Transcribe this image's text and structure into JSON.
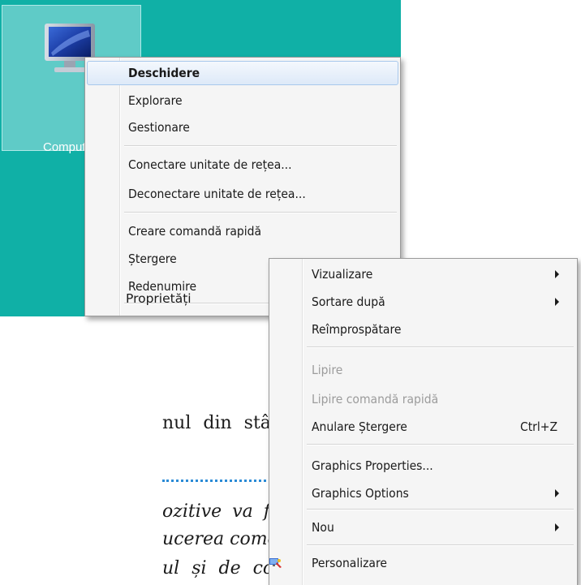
{
  "desktop": {
    "icon_label": "Computer",
    "background": "#10b0a6"
  },
  "context_menu_1": {
    "items": [
      {
        "label": "Deschidere",
        "bold": true,
        "highlighted": true
      },
      {
        "label": "Explorare"
      },
      {
        "label": "Gestionare"
      },
      {
        "label": "Conectare unitate de rețea..."
      },
      {
        "label": "Deconectare unitate de rețea..."
      },
      {
        "label": "Creare comandă rapidă"
      },
      {
        "label": "Ștergere"
      },
      {
        "label": "Redenumire"
      },
      {
        "label": "Proprietăți"
      }
    ]
  },
  "context_menu_2": {
    "items": [
      {
        "label": "Vizualizare",
        "submenu": true
      },
      {
        "label": "Sortare după",
        "submenu": true
      },
      {
        "label": "Reîmprospătare"
      },
      {
        "label": "Lipire",
        "disabled": true
      },
      {
        "label": "Lipire comandă rapidă",
        "disabled": true
      },
      {
        "label": "Anulare Ștergere",
        "shortcut": "Ctrl+Z"
      },
      {
        "label": "Graphics Properties..."
      },
      {
        "label": "Graphics Options",
        "submenu": true
      },
      {
        "label": "Nou",
        "submenu": true
      },
      {
        "label": "Personalizare",
        "icon": "personalize-icon"
      }
    ]
  },
  "page_text": {
    "line1": "nul din stânga apăsat",
    "line2": "ozitive va folosi Ioana",
    "line3": "ucerea comenzilor într-un",
    "line4": "ul și de comunicații de"
  }
}
